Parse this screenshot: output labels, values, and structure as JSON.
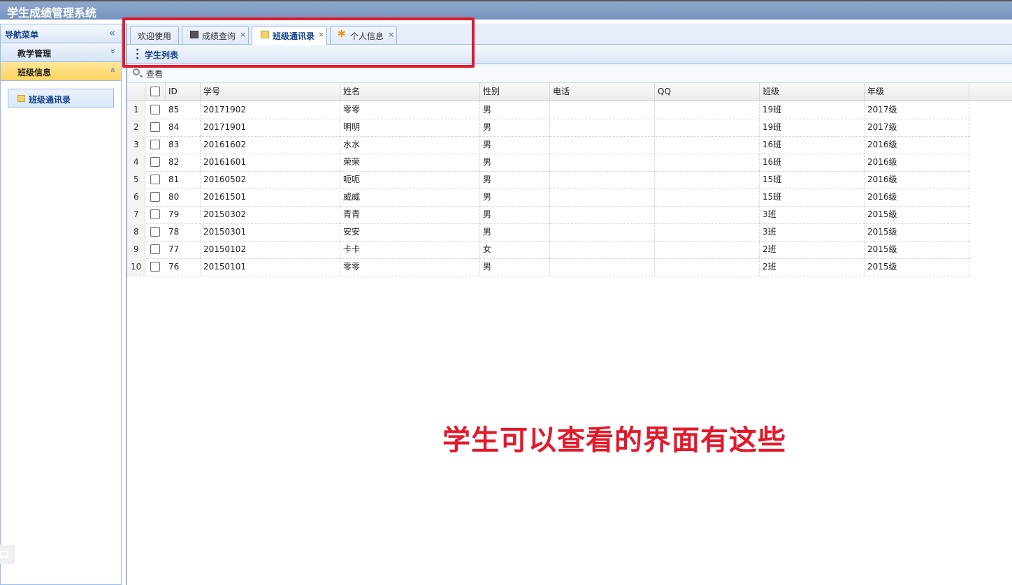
{
  "app": {
    "title": "学生成绩管理系统"
  },
  "nav": {
    "header": "导航菜单",
    "collapse_icon": "«",
    "groups": [
      {
        "label": "教学管理",
        "icon": "»"
      },
      {
        "label": "班级信息",
        "icon": "«"
      }
    ],
    "links": [
      {
        "label": "班级通讯录"
      }
    ]
  },
  "tabs": [
    {
      "label": "欢迎使用",
      "closable": false
    },
    {
      "label": "成绩查询",
      "closable": true,
      "close": "×"
    },
    {
      "label": "班级通讯录",
      "closable": true,
      "close": "×"
    },
    {
      "label": "个人信息",
      "closable": true,
      "close": "×"
    }
  ],
  "panel": {
    "title": "学生列表"
  },
  "toolbar": {
    "view_label": "查看"
  },
  "table": {
    "columns": [
      "ID",
      "学号",
      "姓名",
      "性别",
      "电话",
      "QQ",
      "班级",
      "年级"
    ],
    "rows": [
      [
        "85",
        "20171902",
        "零零",
        "男",
        "",
        "",
        "19班",
        "2017级"
      ],
      [
        "84",
        "20171901",
        "明明",
        "男",
        "",
        "",
        "19班",
        "2017级"
      ],
      [
        "83",
        "20161602",
        "水水",
        "男",
        "",
        "",
        "16班",
        "2016级"
      ],
      [
        "82",
        "20161601",
        "荣荣",
        "男",
        "",
        "",
        "16班",
        "2016级"
      ],
      [
        "81",
        "20160502",
        "呃呃",
        "男",
        "",
        "",
        "15班",
        "2016级"
      ],
      [
        "80",
        "20161501",
        "威威",
        "男",
        "",
        "",
        "15班",
        "2016级"
      ],
      [
        "79",
        "20150302",
        "青青",
        "男",
        "",
        "",
        "3班",
        "2015级"
      ],
      [
        "78",
        "20150301",
        "安安",
        "男",
        "",
        "",
        "3班",
        "2015级"
      ],
      [
        "77",
        "20150102",
        "卡卡",
        "女",
        "",
        "",
        "2班",
        "2015级"
      ],
      [
        "76",
        "20150101",
        "零零",
        "男",
        "",
        "",
        "2班",
        "2015级"
      ]
    ]
  },
  "annotation": {
    "text": "学生可以查看的界面有这些",
    "color": "#e3192b"
  }
}
